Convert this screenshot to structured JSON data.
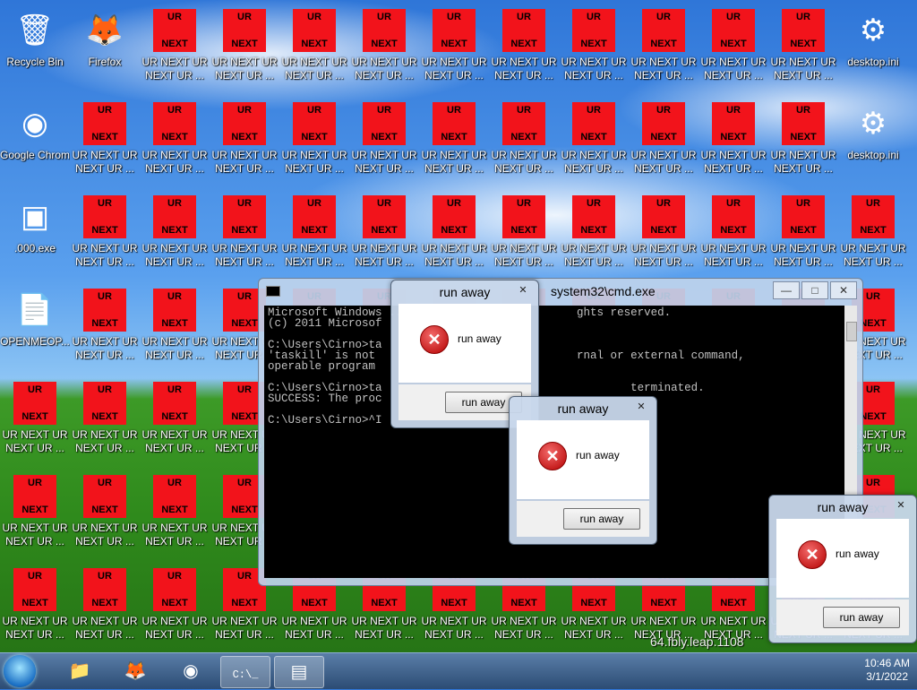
{
  "desktop": {
    "icons": [
      {
        "label": "Recycle Bin",
        "kind": "recycle"
      },
      {
        "label": "Firefox",
        "kind": "firefox"
      },
      {
        "label": "Google Chrome",
        "kind": "chrome"
      },
      {
        "label": ".000.exe",
        "kind": "exe"
      },
      {
        "label": "OPENMEOP...",
        "kind": "doc"
      },
      {
        "label": "desktop.ini",
        "kind": "ini"
      },
      {
        "label": "desktop.ini",
        "kind": "ini"
      }
    ],
    "red_icon": {
      "top": "UR",
      "bottom": "NEXT",
      "label_line1": "UR NEXT UR",
      "label_line2": "NEXT UR ..."
    },
    "bg_text": "64.fbly.leap.1108"
  },
  "cmd": {
    "title": "system32\\cmd.exe",
    "lines": [
      "Microsoft Windows ...                         ghts reserved.",
      "(c) 2011 Microsof",
      "",
      "C:\\Users\\Cirno>ta",
      "'taskill' is not                              rnal or external command,",
      "operable program",
      "",
      "C:\\Users\\Cirno>ta                                     terminated.",
      "SUCCESS: The proc",
      "",
      "C:\\Users\\Cirno>^I"
    ]
  },
  "dialogs": [
    {
      "title": "run away",
      "message": "run away",
      "button": "run away"
    },
    {
      "title": "run away",
      "message": "run away",
      "button": "run away"
    },
    {
      "title": "run away",
      "message": "run away",
      "button": "run away"
    }
  ],
  "taskbar": {
    "items": [
      "explorer",
      "firefox",
      "chrome",
      "cmd",
      "app"
    ],
    "clock_time": "10:46 AM",
    "clock_date": "3/1/2022"
  }
}
